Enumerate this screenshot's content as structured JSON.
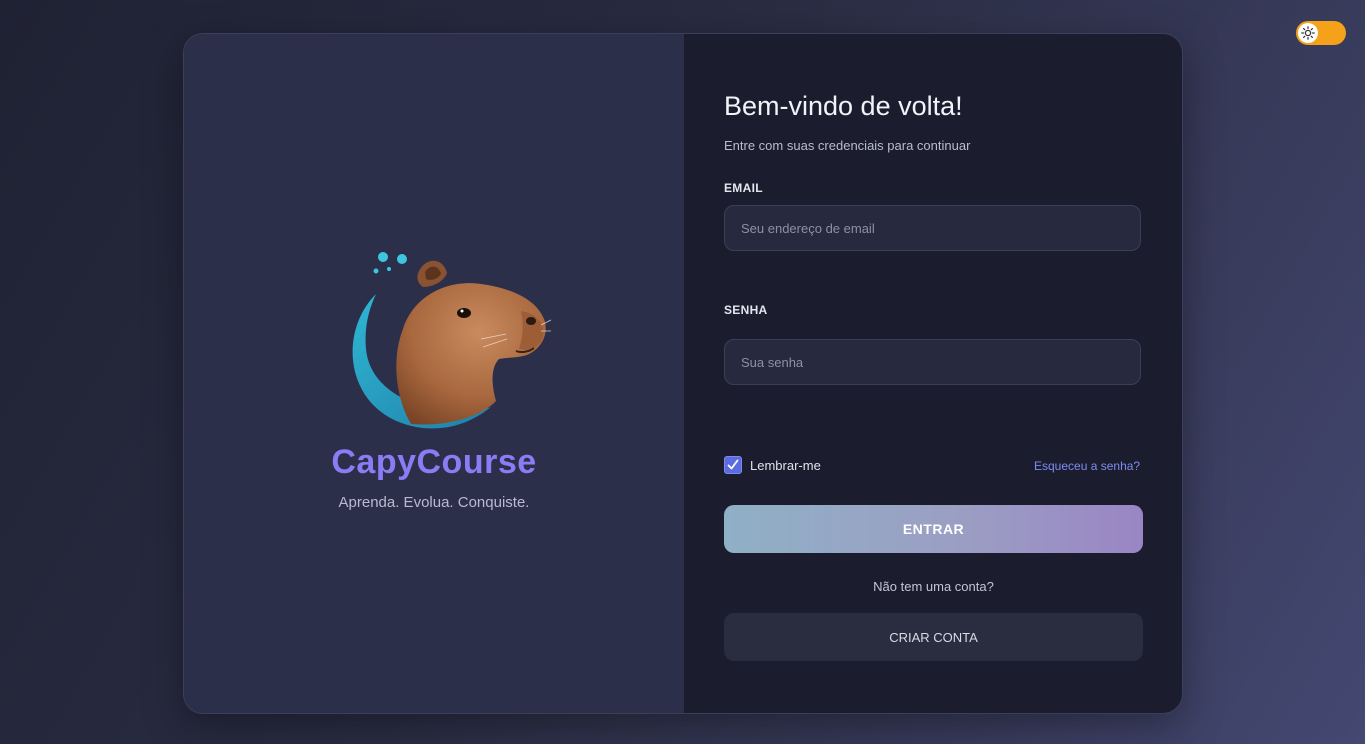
{
  "theme_toggle": {
    "icon": "sun-icon",
    "accent": "#f5a21a"
  },
  "brand": {
    "name": "CapyCourse",
    "tagline": "Aprenda. Evolua. Conquiste.",
    "name_color": "#8a7cf5"
  },
  "login": {
    "title": "Bem-vindo de volta!",
    "subtitle": "Entre com suas credenciais para continuar",
    "email_label": "EMAIL",
    "email_placeholder": "Seu endereço de email",
    "email_value": "",
    "password_label": "SENHA",
    "password_placeholder": "Sua senha",
    "password_value": "",
    "remember_label": "Lembrar-me",
    "remember_checked": true,
    "forgot_label": "Esqueceu a senha?",
    "submit_label": "ENTRAR",
    "no_account_text": "Não tem uma conta?",
    "create_account_label": "CRIAR CONTA"
  },
  "colors": {
    "accent": "#7c8cf0",
    "checkbox": "#5b6be0"
  }
}
